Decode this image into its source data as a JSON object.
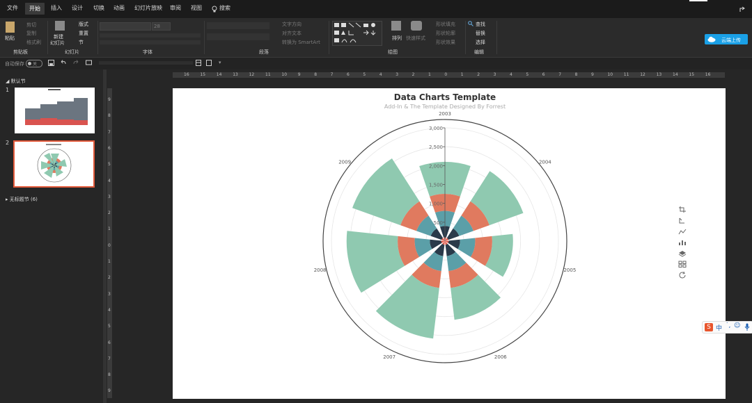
{
  "tabs": [
    "文件",
    "开始",
    "插入",
    "设计",
    "切换",
    "动画",
    "幻灯片放映",
    "审阅",
    "视图"
  ],
  "active_tab": "开始",
  "search_placeholder": "搜索",
  "ribbon": {
    "clipboard": {
      "paste": "粘贴",
      "cut": "剪切",
      "copy": "复制",
      "format_painter": "格式刷",
      "label": "剪贴板"
    },
    "slides": {
      "new_slide": "新建",
      "new_slide2": "幻灯片",
      "layout": "版式",
      "reset": "重置",
      "section": "节",
      "label": "幻灯片"
    },
    "font": {
      "size": "28",
      "label": "字体"
    },
    "paragraph": {
      "text_direction": "文字方向",
      "align_text": "对齐文本",
      "smartart": "转换为 SmartArt",
      "label": "段落"
    },
    "drawing": {
      "arrange": "排列",
      "quick_styles": "快速样式",
      "fill": "形状填充",
      "outline": "形状轮廓",
      "effects": "形状效果",
      "label": "绘图"
    },
    "editing": {
      "find": "查找",
      "replace": "替换",
      "select": "选择",
      "label": "编辑"
    },
    "upload": "云端上传"
  },
  "quickbar": {
    "autosave": "自动保存",
    "toggle": "关"
  },
  "left_pane": {
    "section_default": "默认节",
    "section_untitled": "无标题节 (6)",
    "thumb1_num": "1",
    "thumb2_num": "2"
  },
  "hruler_labels": [
    "16",
    "15",
    "14",
    "13",
    "12",
    "11",
    "10",
    "9",
    "8",
    "7",
    "6",
    "5",
    "4",
    "3",
    "2",
    "1",
    "0",
    "1",
    "2",
    "3",
    "4",
    "5",
    "6",
    "7",
    "8",
    "9",
    "10",
    "11",
    "12",
    "13",
    "14",
    "15",
    "16"
  ],
  "vruler_labels": [
    "9",
    "8",
    "7",
    "6",
    "5",
    "4",
    "3",
    "2",
    "1",
    "0",
    "1",
    "2",
    "3",
    "4",
    "5",
    "6",
    "7",
    "8",
    "9"
  ],
  "chart_data": {
    "type": "polar bar",
    "title": "Data Charts Template",
    "subtitle": "Add-In & The Template Designed By Forrest",
    "categories": [
      "2003",
      "2004",
      "2005",
      "2006",
      "2007",
      "2008",
      "2009"
    ],
    "radial_ticks": [
      "3,000",
      "2,500",
      "2,000",
      "1,500",
      "1,000",
      "500"
    ],
    "radial_max": 3000,
    "series": [
      {
        "color": "#e05a4a",
        "values": [
          100,
          100,
          100,
          100,
          100,
          100,
          100
        ]
      },
      {
        "color": "#2a3a4a",
        "values": [
          400,
          400,
          400,
          400,
          400,
          400,
          400
        ]
      },
      {
        "color": "#5b9fa8",
        "values": [
          800,
          800,
          800,
          800,
          800,
          800,
          800
        ]
      },
      {
        "color": "#e07a5f",
        "values": [
          1250,
          1250,
          1250,
          1250,
          1250,
          1250,
          1250
        ]
      },
      {
        "color": "#8fc9b0",
        "values": [
          2100,
          2200,
          1800,
          2100,
          2600,
          2600,
          2600
        ]
      }
    ],
    "grid": true
  },
  "colors": {
    "accent": "#e2593a",
    "upload": "#1aa0e6",
    "bg": "#262626"
  }
}
